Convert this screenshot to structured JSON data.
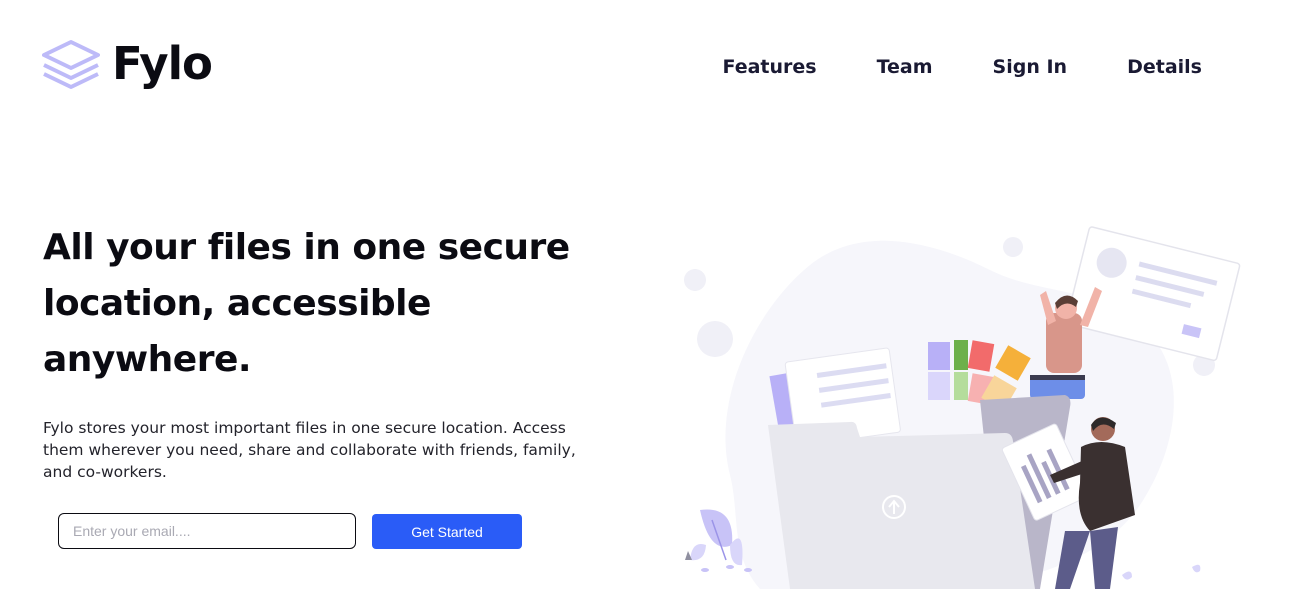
{
  "brand": {
    "name": "Fylo",
    "logo_icon": "stacked-layers-icon",
    "accent_color": "#bdbaf8"
  },
  "nav": {
    "items": [
      {
        "label": "Features"
      },
      {
        "label": "Team"
      },
      {
        "label": "Sign In"
      },
      {
        "label": "Details"
      }
    ]
  },
  "hero": {
    "headline": "All your files in one secure location, accessible anywhere.",
    "description": "Fylo stores your most important files in one secure location. Access them wherever you need, share and collaborate with friends, family, and co-workers.",
    "email_placeholder": "Enter your email....",
    "email_value": "",
    "cta_label": "Get Started",
    "cta_color": "#2a5cf7",
    "illustration": "people-organizing-files-illustration"
  }
}
